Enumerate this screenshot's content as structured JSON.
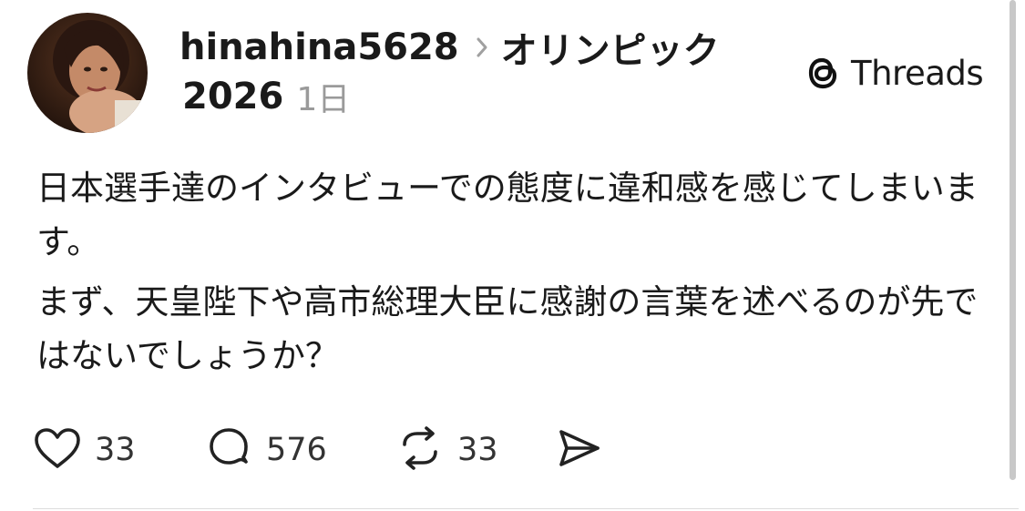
{
  "post": {
    "username": "hinahina5628",
    "topic_line1": "オリンピック",
    "topic_line2": "2026",
    "time": "1日",
    "body": [
      "日本選手達のインタビューでの態度に違和感を感じてしまいます。",
      "まず、天皇陛下や高市総理大臣に感謝の言葉を述べるのが先ではないでしょうか？"
    ]
  },
  "brand": {
    "label": "Threads"
  },
  "actions": {
    "likes": "33",
    "replies": "576",
    "reposts": "33"
  },
  "icons": {
    "avatar": "profile-photo",
    "chevron": "chevron-right-icon",
    "brand": "threads-logo-icon",
    "like": "heart-icon",
    "reply": "speech-bubble-icon",
    "repost": "repost-icon",
    "share": "send-icon"
  },
  "colors": {
    "text": "#1a1a1a",
    "muted": "#9a9a9a",
    "divider": "#dcdcdc",
    "scrollbar": "#c8c8c8"
  }
}
